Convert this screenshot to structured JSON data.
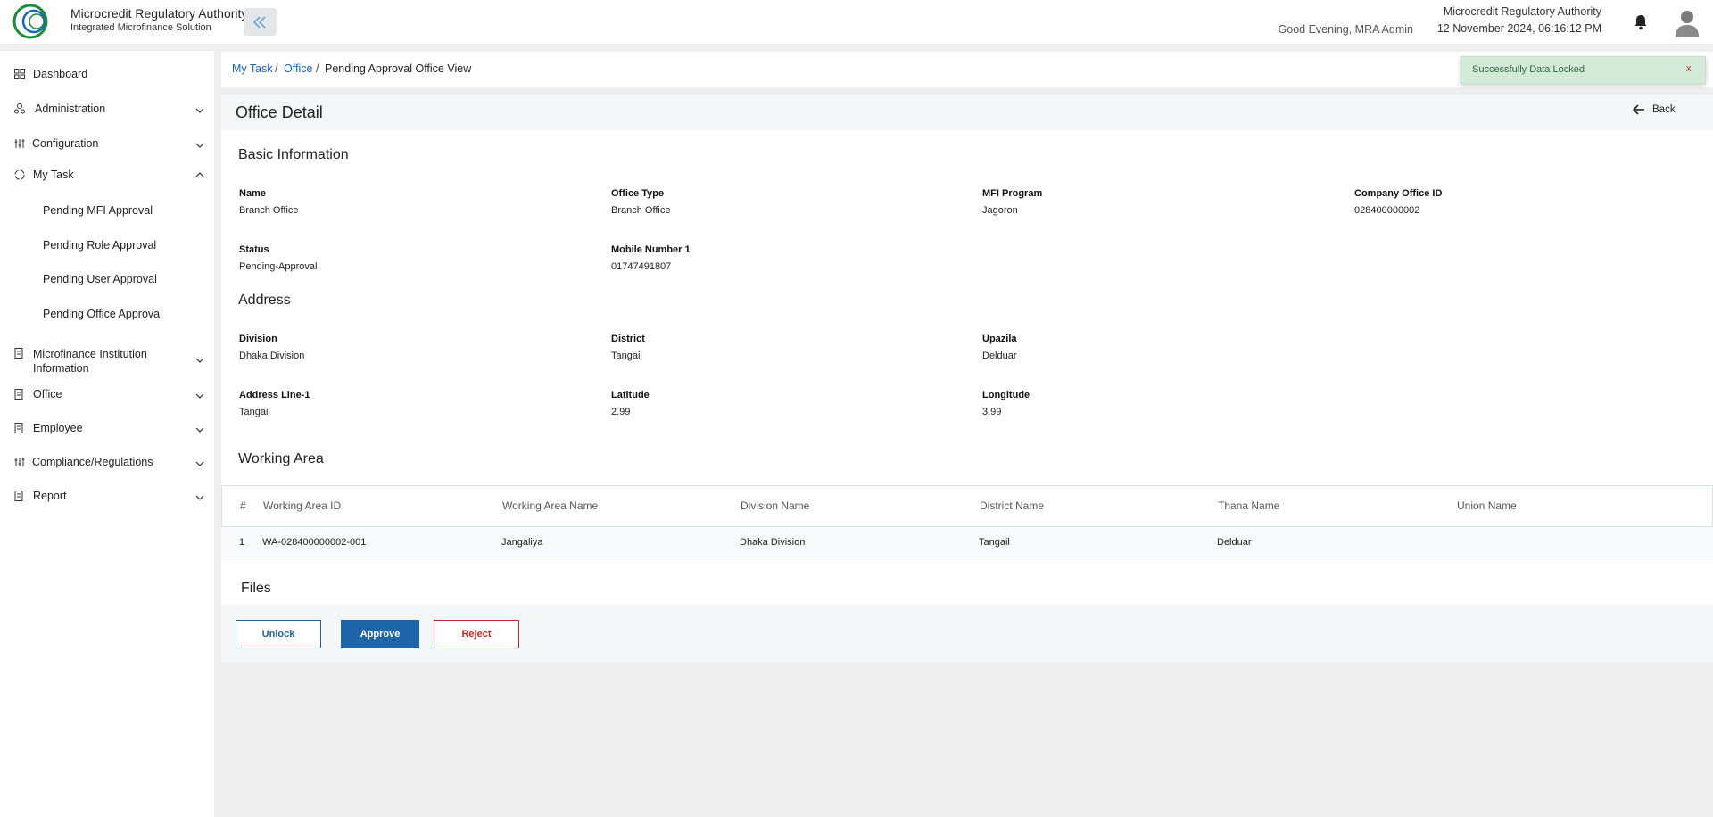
{
  "header": {
    "logo_text": "Microcredit Regulatory Authority",
    "org_name": "Microcredit Regulatory Authority",
    "subtitle": "Integrated Microfinance Solution",
    "greeting": "Good Evening, MRA Admin",
    "right_org": "Microcredit Regulatory Authority",
    "datetime": "12 November 2024, 06:16:12 PM",
    "brand_color": "#1e8a3c"
  },
  "sidebar": {
    "items": [
      {
        "label": "Dashboard",
        "icon": "grid-icon"
      },
      {
        "label": "Administration",
        "icon": "admin-icon"
      },
      {
        "label": "Configuration",
        "icon": "sliders-icon"
      },
      {
        "label": "My Task",
        "icon": "task-icon"
      },
      {
        "label": "Microfinance Institution Information",
        "icon": "document-icon"
      },
      {
        "label": "Office",
        "icon": "document-icon"
      },
      {
        "label": "Employee",
        "icon": "document-icon"
      },
      {
        "label": "Compliance/Regulations",
        "icon": "sliders-icon"
      },
      {
        "label": "Report",
        "icon": "document-icon"
      }
    ],
    "my_task_sub": [
      "Pending MFI Approval",
      "Pending Role Approval",
      "Pending User Approval",
      "Pending Office Approval"
    ]
  },
  "breadcrumb": {
    "items": [
      "My Task",
      "Office",
      "Pending Approval Office View"
    ],
    "separator": "/"
  },
  "toast": {
    "message": "Successfully Data Locked",
    "close": "x"
  },
  "page": {
    "title": "Office Detail",
    "back": "Back"
  },
  "basic_info": {
    "title": "Basic Information",
    "fields": [
      {
        "label": "Name",
        "value": "Branch Office"
      },
      {
        "label": "Office Type",
        "value": "Branch Office"
      },
      {
        "label": "MFI Program",
        "value": "Jagoron"
      },
      {
        "label": "Company Office ID",
        "value": "028400000002"
      },
      {
        "label": "Status",
        "value": "Pending-Approval"
      },
      {
        "label": "Mobile Number 1",
        "value": "01747491807"
      }
    ]
  },
  "address": {
    "title": "Address",
    "fields": [
      {
        "label": "Division",
        "value": "Dhaka Division"
      },
      {
        "label": "District",
        "value": "Tangail"
      },
      {
        "label": "Upazila",
        "value": "Delduar"
      },
      {
        "label": "Address Line-1",
        "value": "Tangail"
      },
      {
        "label": "Latitude",
        "value": "2.99"
      },
      {
        "label": "Longitude",
        "value": "3.99"
      }
    ]
  },
  "working_area": {
    "title": "Working Area",
    "columns": [
      "#",
      "Working Area ID",
      "Working Area Name",
      "Division Name",
      "District Name",
      "Thana Name",
      "Union Name"
    ],
    "rows": [
      [
        "1",
        "WA-028400000002-001",
        "Jangaliya",
        "Dhaka Division",
        "Tangail",
        "Delduar",
        ""
      ]
    ]
  },
  "files": {
    "title": "Files"
  },
  "actions": {
    "unlock": "Unlock",
    "approve": "Approve",
    "reject": "Reject"
  }
}
